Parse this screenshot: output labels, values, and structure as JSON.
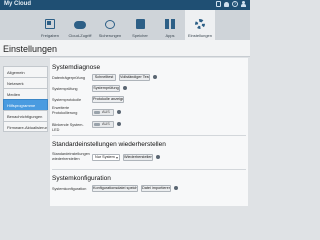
{
  "app": {
    "brand": "My Cloud"
  },
  "topbar": {
    "extra_label": ""
  },
  "nav": [
    {
      "label": "Freigaben",
      "icon": "shares-icon"
    },
    {
      "label": "Cloud-Zugriff",
      "icon": "cloud-icon"
    },
    {
      "label": "Sicherungen",
      "icon": "backup-icon"
    },
    {
      "label": "Speicher",
      "icon": "storage-icon"
    },
    {
      "label": "Apps",
      "icon": "apps-icon"
    },
    {
      "label": "Einstellungen",
      "icon": "gear-icon",
      "active": true
    }
  ],
  "page": {
    "title": "Einstellungen"
  },
  "menu": [
    {
      "label": "Allgemein"
    },
    {
      "label": "Netzwerk"
    },
    {
      "label": "Medien"
    },
    {
      "label": "Hilfsprogramme",
      "active": true
    },
    {
      "label": "Benachrichtigungen"
    },
    {
      "label": "Firmware-Aktualisierung"
    }
  ],
  "diag": {
    "title": "Systemdiagnose",
    "r1_label": "Datenträgerprüfung",
    "r1_btn1": "Schnelltest",
    "r1_btn2": "Vollständiger Test",
    "r2_label": "Systemprüfung",
    "r2_btn": "Systemprüfung",
    "r3_label": "Systemprotokolle",
    "r3_btn": "Protokolle anzeigen",
    "r4_label": "Erweiterte Protokollierung",
    "r4_toggle": "AUS",
    "r5_label": "Blinkende System-LED",
    "r5_toggle": "AUS"
  },
  "restore": {
    "title": "Standardeinstellungen wiederherstellen",
    "label": "Standardeinstellungen wiederherstellen",
    "select": "Nur System",
    "btn": "Wiederherstellen"
  },
  "config": {
    "title": "Systemkonfiguration",
    "label": "Systemkonfiguration",
    "btn1": "Konfigurationsdatei speichern",
    "btn2": "Datei importieren"
  }
}
